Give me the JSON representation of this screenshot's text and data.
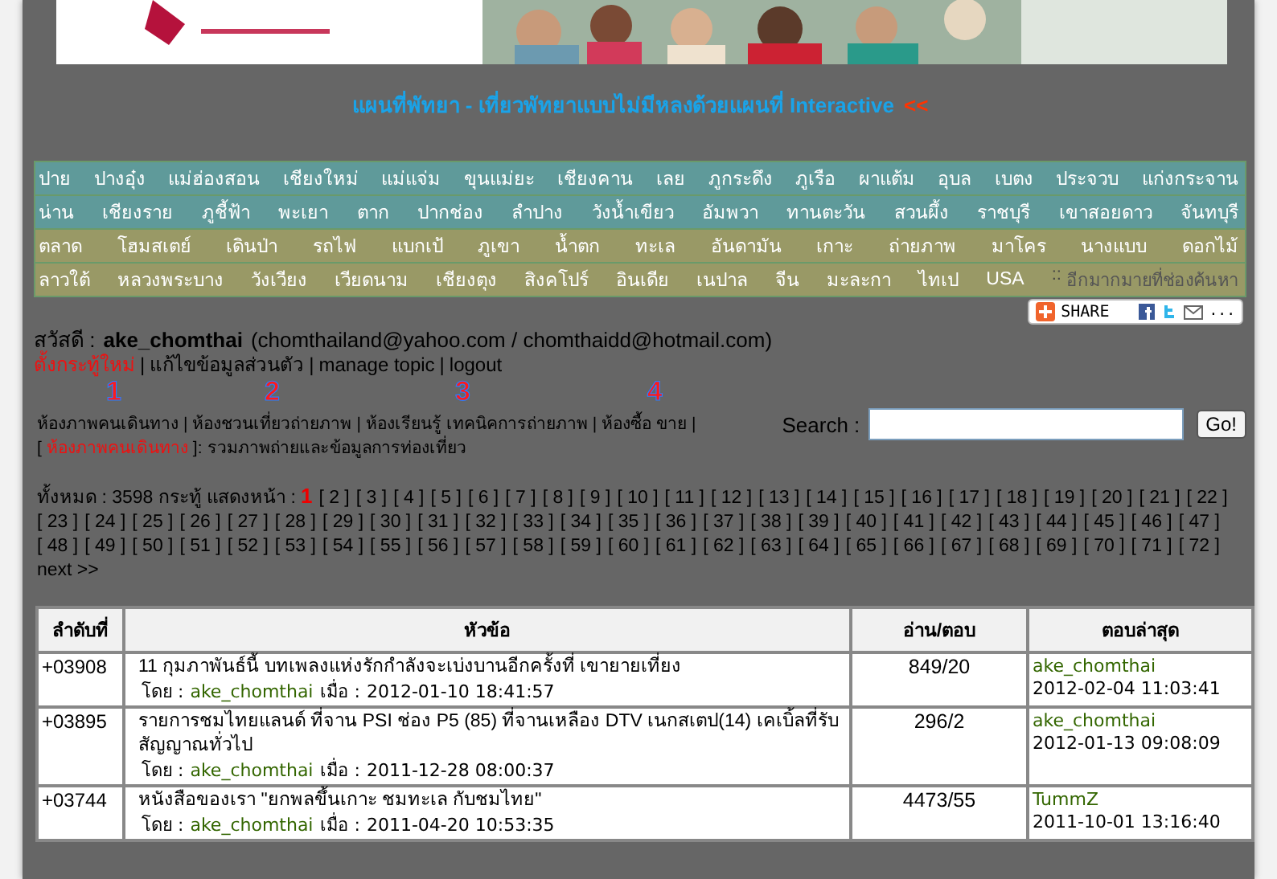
{
  "promo_link": {
    "text": "แผนที่พัทยา - เที่ยวพัทยาแบบไม่มีหลงด้วยแผนที่ Interactive",
    "arrow": "<<"
  },
  "nav_rows": [
    {
      "color": "#5f9a9a",
      "items": [
        "ปาย",
        "ปางอุ๋ง",
        "แม่ฮ่องสอน",
        "เชียงใหม่",
        "แม่แจ่ม",
        "ขุนแม่ยะ",
        "เชียงคาน",
        "เลย",
        "ภูกระดึง",
        "ภูเรือ",
        "ผาแต้ม",
        "อุบล",
        "เบตง",
        "ประจวบ",
        "แก่งกระจาน"
      ]
    },
    {
      "color": "#5f9a9a",
      "items": [
        "น่าน",
        "เชียงราย",
        "ภูชี้ฟ้า",
        "พะเยา",
        "ตาก",
        "ปากช่อง",
        "ลำปาง",
        "วังน้ำเขียว",
        "อัมพวา",
        "ทานตะวัน",
        "สวนผึ้ง",
        "ราชบุรี",
        "เขาสอยดาว",
        "จันทบุรี"
      ]
    },
    {
      "color": "#999966",
      "items": [
        "ตลาด",
        "โฮมสเตย์",
        "เดินป่า",
        "รถไฟ",
        "แบกเป้",
        "ภูเขา",
        "น้ำตก",
        "ทะเล",
        "อันดามัน",
        "เกาะ",
        "ถ่ายภาพ",
        "มาโคร",
        "นางแบบ",
        "ดอกไม้"
      ]
    },
    {
      "color": "#999966",
      "items": [
        "ลาวใต้",
        "หลวงพระบาง",
        "วังเวียง",
        "เวียดนาม",
        "เชียงตุง",
        "สิงคโปร์",
        "อินเดีย",
        "เนปาล",
        "จีน",
        "มะละกา",
        "ไทเป",
        "USA"
      ],
      "more_sep": "::",
      "more": "อีกมากมายที่ช่องค้นหา"
    }
  ],
  "share_button": {
    "label": "SHARE",
    "more": "..."
  },
  "greeting": {
    "label": "สวัสดี :",
    "username": "ake_chomthai",
    "emails": "(chomthailand@yahoo.com / chomthaidd@hotmail.com)"
  },
  "user_links": [
    {
      "text": "ตั้งกระทู้ใหม่",
      "highlighted": true,
      "separator": "|"
    },
    {
      "text": "แก้ไขข้อมูลส่วนตัว",
      "highlighted": false,
      "separator": "|"
    },
    {
      "text": "manage topic",
      "highlighted": false,
      "separator": "|"
    },
    {
      "text": "logout",
      "highlighted": false
    }
  ],
  "step_numbers": [
    "1",
    "2",
    "3",
    "4"
  ],
  "rooms": [
    {
      "name": "ห้องภาพคนเดินทาง",
      "separator": "|"
    },
    {
      "name": "ห้องชวนเที่ยวถ่ายภาพ",
      "separator": "|"
    },
    {
      "name": "ห้องเรียนรู้ เทคนิคการถ่ายภาพ",
      "separator": "|"
    },
    {
      "name": "ห้องซื้อ ขาย",
      "separator": "|"
    }
  ],
  "current_room": {
    "open": "[",
    "name": "ห้องภาพคนเดินทาง",
    "close": "]:",
    "description": "รวมภาพถ่ายและข้อมูลการท่องเที่ยว"
  },
  "search": {
    "label": "Search :",
    "button": "Go!"
  },
  "pagination": {
    "summary": "ทั้งหมด : 3598 กระทู้ แสดงหน้า :",
    "next": "next >>",
    "pages": [
      {
        "label": "1",
        "selected": true
      },
      {
        "label": "[ 2 ]",
        "selected": false
      },
      {
        "label": "[ 3 ]",
        "selected": false
      },
      {
        "label": "[ 4 ]",
        "selected": false
      },
      {
        "label": "[ 5 ]",
        "selected": false
      },
      {
        "label": "[ 6 ]",
        "selected": false
      },
      {
        "label": "[ 7 ]",
        "selected": false
      },
      {
        "label": "[ 8 ]",
        "selected": false
      },
      {
        "label": "[ 9 ]",
        "selected": false
      },
      {
        "label": "[ 10 ]",
        "selected": false
      },
      {
        "label": "[ 11 ]",
        "selected": false
      },
      {
        "label": "[ 12 ]",
        "selected": false
      },
      {
        "label": "[ 13 ]",
        "selected": false
      },
      {
        "label": "[ 14 ]",
        "selected": false
      },
      {
        "label": "[ 15 ]",
        "selected": false
      },
      {
        "label": "[ 16 ]",
        "selected": false
      },
      {
        "label": "[ 17 ]",
        "selected": false
      },
      {
        "label": "[ 18 ]",
        "selected": false
      },
      {
        "label": "[ 19 ]",
        "selected": false
      },
      {
        "label": "[ 20 ]",
        "selected": false
      },
      {
        "label": "[ 21 ]",
        "selected": false
      },
      {
        "label": "[ 22 ]",
        "selected": false
      },
      {
        "label": "[ 23 ]",
        "selected": false
      },
      {
        "label": "[ 24 ]",
        "selected": false
      },
      {
        "label": "[ 25 ]",
        "selected": false
      },
      {
        "label": "[ 26 ]",
        "selected": false
      },
      {
        "label": "[ 27 ]",
        "selected": false
      },
      {
        "label": "[ 28 ]",
        "selected": false
      },
      {
        "label": "[ 29 ]",
        "selected": false
      },
      {
        "label": "[ 30 ]",
        "selected": false
      },
      {
        "label": "[ 31 ]",
        "selected": false
      },
      {
        "label": "[ 32 ]",
        "selected": false
      },
      {
        "label": "[ 33 ]",
        "selected": false
      },
      {
        "label": "[ 34 ]",
        "selected": false
      },
      {
        "label": "[ 35 ]",
        "selected": false
      },
      {
        "label": "[ 36 ]",
        "selected": false
      },
      {
        "label": "[ 37 ]",
        "selected": false
      },
      {
        "label": "[ 38 ]",
        "selected": false
      },
      {
        "label": "[ 39 ]",
        "selected": false
      },
      {
        "label": "[ 40 ]",
        "selected": false
      },
      {
        "label": "[ 41 ]",
        "selected": false
      },
      {
        "label": "[ 42 ]",
        "selected": false
      },
      {
        "label": "[ 43 ]",
        "selected": false
      },
      {
        "label": "[ 44 ]",
        "selected": false
      },
      {
        "label": "[ 45 ]",
        "selected": false
      },
      {
        "label": "[ 46 ]",
        "selected": false
      },
      {
        "label": "[ 47 ]",
        "selected": false
      },
      {
        "label": "[ 48 ]",
        "selected": false
      },
      {
        "label": "[ 49 ]",
        "selected": false
      },
      {
        "label": "[ 50 ]",
        "selected": false
      },
      {
        "label": "[ 51 ]",
        "selected": false
      },
      {
        "label": "[ 52 ]",
        "selected": false
      },
      {
        "label": "[ 53 ]",
        "selected": false
      },
      {
        "label": "[ 54 ]",
        "selected": false
      },
      {
        "label": "[ 55 ]",
        "selected": false
      },
      {
        "label": "[ 56 ]",
        "selected": false
      },
      {
        "label": "[ 57 ]",
        "selected": false
      },
      {
        "label": "[ 58 ]",
        "selected": false
      },
      {
        "label": "[ 59 ]",
        "selected": false
      },
      {
        "label": "[ 60 ]",
        "selected": false
      },
      {
        "label": "[ 61 ]",
        "selected": false
      },
      {
        "label": "[ 62 ]",
        "selected": false
      },
      {
        "label": "[ 63 ]",
        "selected": false
      },
      {
        "label": "[ 64 ]",
        "selected": false
      },
      {
        "label": "[ 65 ]",
        "selected": false
      },
      {
        "label": "[ 66 ]",
        "selected": false
      },
      {
        "label": "[ 67 ]",
        "selected": false
      },
      {
        "label": "[ 68 ]",
        "selected": false
      },
      {
        "label": "[ 69 ]",
        "selected": false
      },
      {
        "label": "[ 70 ]",
        "selected": false
      },
      {
        "label": "[ 71 ]",
        "selected": false
      },
      {
        "label": "[ 72 ]",
        "selected": false
      }
    ]
  },
  "table": {
    "columns": [
      "ลำดับที่",
      "หัวข้อ",
      "อ่าน/ตอบ",
      "ตอบล่าสุด"
    ],
    "rows": [
      {
        "number": "+03908",
        "title": "11 กุมภาพันธ์นี้ บทเพลงแห่งรักกำลังจะเบ่งบานอีกครั้งที่ เขายายเที่ยง",
        "by_label": "โดย :",
        "author": "ake_chomthai",
        "when_label": "เมื่อ :",
        "date": "2012-01-10 18:41:57",
        "read_reply": "849/20",
        "last_user": "ake_chomthai",
        "last_date": "2012-02-04 11:03:41"
      },
      {
        "number": "+03895",
        "title": "รายการชมไทยแลนด์ ที่จาน PSI ช่อง P5 (85) ที่จานเหลือง DTV เนกสเตป(14) เคเบิ้ลที่รับสัญญาณทั่วไป",
        "by_label": "โดย :",
        "author": "ake_chomthai",
        "when_label": "เมื่อ :",
        "date": "2011-12-28 08:00:37",
        "read_reply": "296/2",
        "last_user": "ake_chomthai",
        "last_date": "2012-01-13 09:08:09"
      },
      {
        "number": "+03744",
        "title": "หนังสือของเรา \"ยกพลขึ้นเกาะ ชมทะเล กับชมไทย\"",
        "by_label": "โดย :",
        "author": "ake_chomthai",
        "when_label": "เมื่อ :",
        "date": "2011-04-20 10:53:35",
        "read_reply": "4473/55",
        "last_user": "TummZ",
        "last_date": "2011-10-01 13:16:40"
      }
    ]
  }
}
